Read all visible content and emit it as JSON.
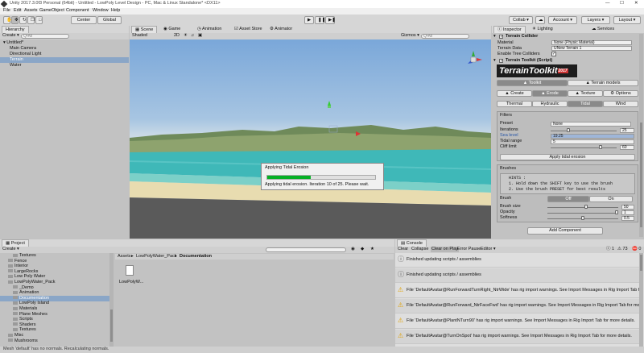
{
  "window_title": "Unity 2017.3.0f3 Personal (64bit) - Untitled - LowPoly Level Design - PC, Mac & Linux Standalone* <DX11>",
  "menu": [
    "File",
    "Edit",
    "Assets",
    "GameObject",
    "Component",
    "Window",
    "Help"
  ],
  "toolbar": {
    "center_label": "Center",
    "global_label": "Global",
    "collab_label": "Collab ▾",
    "account_label": "Account ▾",
    "layers_label": "Layers",
    "layout_label": "Layout"
  },
  "hierarchy": {
    "tab": "Hierarchy",
    "create": "Create ▾",
    "search_placeholder": "Q•All",
    "scene": "Untitled*",
    "items": [
      "Main Camera",
      "Directional Light",
      "Terrain",
      "Water"
    ],
    "selected_index": 2
  },
  "scene_tabs": [
    "Scene",
    "Game",
    "Animation",
    "Asset Store",
    "Animator"
  ],
  "scene_toolbar": {
    "shading": "Shaded",
    "mode_2d": "2D",
    "gizmos": "Gizmos ▾",
    "search": "Q•All"
  },
  "progress": {
    "title": "Applying Tidal Erosion",
    "message": "Applying tidal erosion. Iteration 10 of 25. Please wait.",
    "fraction": 0.4
  },
  "inspector": {
    "tabs": [
      "Inspector",
      "Lighting",
      "Services"
    ],
    "terrain_collider": {
      "title": "Terrain Collider",
      "rows": [
        {
          "label": "Material",
          "value": "None (Physic Material)"
        },
        {
          "label": "Terrain Data",
          "value": "UNew Terrain 1"
        },
        {
          "label": "Enable Tree Colliders",
          "value": ""
        }
      ]
    },
    "toolkit": {
      "title": "Terrain Toolkit (Script)",
      "logo": "TerrainToolkit",
      "logo_year": "2017",
      "main_tabs": [
        "Toolkit",
        "Terrain models"
      ],
      "mode_tabs": [
        "Create",
        "Erode",
        "Texture",
        "Options"
      ],
      "erosion_tabs": [
        "Thermal",
        "Hydraulic",
        "Tidal",
        "Wind"
      ],
      "filters_label": "Filters",
      "preset_label": "Preset",
      "preset_value": "None",
      "iterations_label": "Iterations",
      "iterations_value": "25",
      "sea_level_label": "Sea level",
      "sea_level_value": "19.25",
      "tidal_range_label": "Tidal range",
      "tidal_range_value": "5",
      "cliff_limit_label": "Cliff limit",
      "cliff_limit_value": "60",
      "apply_label": "Apply tidal erosion",
      "brushes_label": "Brushes",
      "hints": [
        "HINTS :",
        "1. Hold down the SHIFT key to use the brush",
        "2. Use the brush PRESET for best results"
      ],
      "brush_label": "Brush",
      "brush_off": "Off",
      "brush_on": "On",
      "brush_size_label": "Brush size",
      "brush_size_value": "50",
      "opacity_label": "Opacity",
      "opacity_value": "1",
      "softness_label": "Softness",
      "softness_value": "0.5"
    },
    "add_component": "Add Component"
  },
  "project": {
    "tab": "Project",
    "create": "Create ▾",
    "tree": [
      {
        "label": "Textures",
        "indent": 2
      },
      {
        "label": "Fence",
        "indent": 1
      },
      {
        "label": "Interior",
        "indent": 1
      },
      {
        "label": "LargeRocks",
        "indent": 1
      },
      {
        "label": "Low Poly Water",
        "indent": 1
      },
      {
        "label": "LowPolyWater_Pack",
        "indent": 1
      },
      {
        "label": "_Demo",
        "indent": 2
      },
      {
        "label": "Animation",
        "indent": 2
      },
      {
        "label": "Documentation",
        "indent": 2
      },
      {
        "label": "LowPoly Island",
        "indent": 2
      },
      {
        "label": "Materials",
        "indent": 2
      },
      {
        "label": "Plane Meshes",
        "indent": 2
      },
      {
        "label": "Scripts",
        "indent": 2
      },
      {
        "label": "Shaders",
        "indent": 2
      },
      {
        "label": "Textures",
        "indent": 2
      },
      {
        "label": "Misc",
        "indent": 1
      },
      {
        "label": "Mushrooms",
        "indent": 1
      }
    ],
    "selected_index": 8,
    "breadcrumb": [
      "Assets",
      "LowPolyWater_Pack",
      "Documentation"
    ],
    "file": "LowPolyW..."
  },
  "console": {
    "tab": "Console",
    "buttons": [
      "Clear",
      "Collapse",
      "Clear on Play",
      "Error Pause",
      "Editor ▾"
    ],
    "counts": {
      "info": "1",
      "warn": "73",
      "error": "0"
    },
    "entries": [
      {
        "type": "info",
        "text": "Finished updating scripts / assemblies"
      },
      {
        "type": "info",
        "text": "Finished updating scripts / assemblies"
      },
      {
        "type": "warn",
        "text": "File 'DefaultAvatar@RunForwardTurnRight_NtrWide' has rig import warnings. See Import Messages in Rig Import Tab for more"
      },
      {
        "type": "warn",
        "text": "File 'DefaultAvatar@RunForward_NtrFaceFwd' has rig import warnings. See Import Messages in Rig Import Tab for more"
      },
      {
        "type": "warn",
        "text": "File 'DefaultAvatar@PlantNTurn90' has rig import warnings. See Import Messages in Rig Import Tab for more details."
      },
      {
        "type": "warn",
        "text": "File 'DefaultAvatar@TurnOnSpot' has rig import warnings. See Import Messages in Rig Import Tab for more details."
      }
    ]
  },
  "status": "Mesh 'default' has no normals. Recalculating normals."
}
